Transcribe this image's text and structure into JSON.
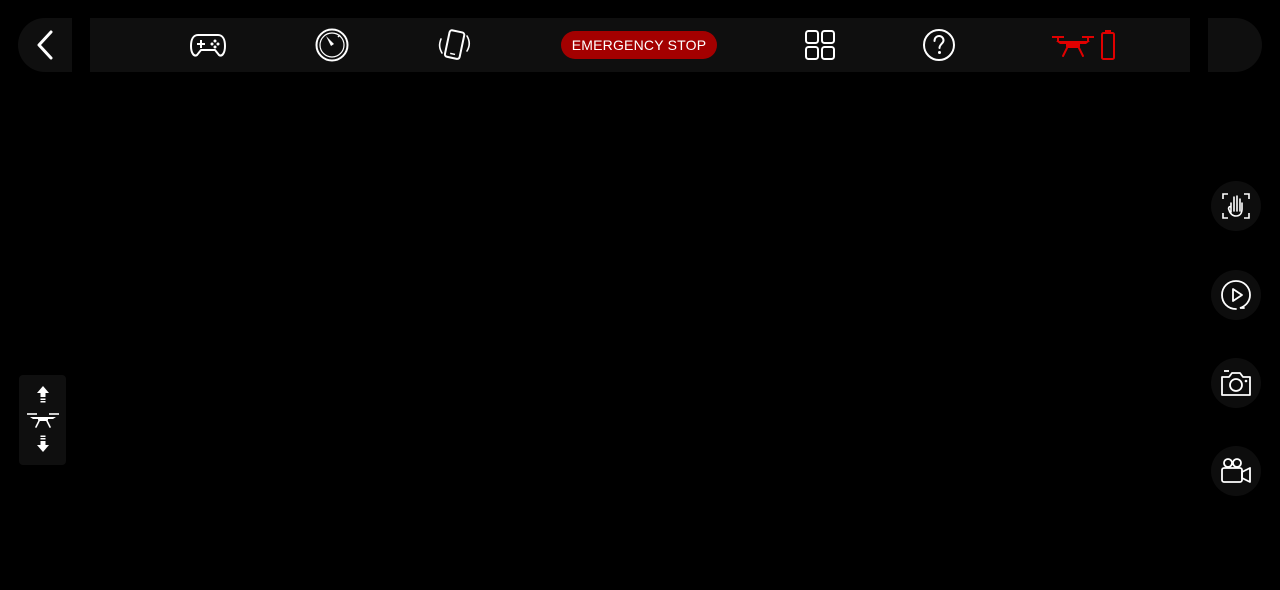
{
  "header": {
    "back_icon": "chevron-left-icon",
    "buttons": [
      {
        "name": "gamepad",
        "icon": "gamepad-icon"
      },
      {
        "name": "speedometer",
        "icon": "speedometer-icon"
      },
      {
        "name": "phone-tilt",
        "icon": "phone-tilt-icon"
      },
      {
        "name": "apps-grid",
        "icon": "grid-icon"
      },
      {
        "name": "help",
        "icon": "question-icon"
      }
    ],
    "emergency_stop_label": "EMERGENCY STOP",
    "status": {
      "drone_icon": "drone-icon",
      "battery_icon": "battery-icon"
    }
  },
  "side_controls": [
    {
      "name": "gesture",
      "icon": "gesture-hand-icon"
    },
    {
      "name": "playback",
      "icon": "play-icon"
    },
    {
      "name": "photo",
      "icon": "camera-icon"
    },
    {
      "name": "video",
      "icon": "video-camera-icon"
    }
  ],
  "altitude_controls": {
    "up_icon": "arrow-up-icon",
    "drone_icon": "drone-icon",
    "down_icon": "arrow-down-icon"
  },
  "colors": {
    "background": "#000000",
    "panel": "#0f0f0f",
    "accent_red": "#a30000",
    "status_red": "#e00000",
    "icon": "#ffffff"
  }
}
